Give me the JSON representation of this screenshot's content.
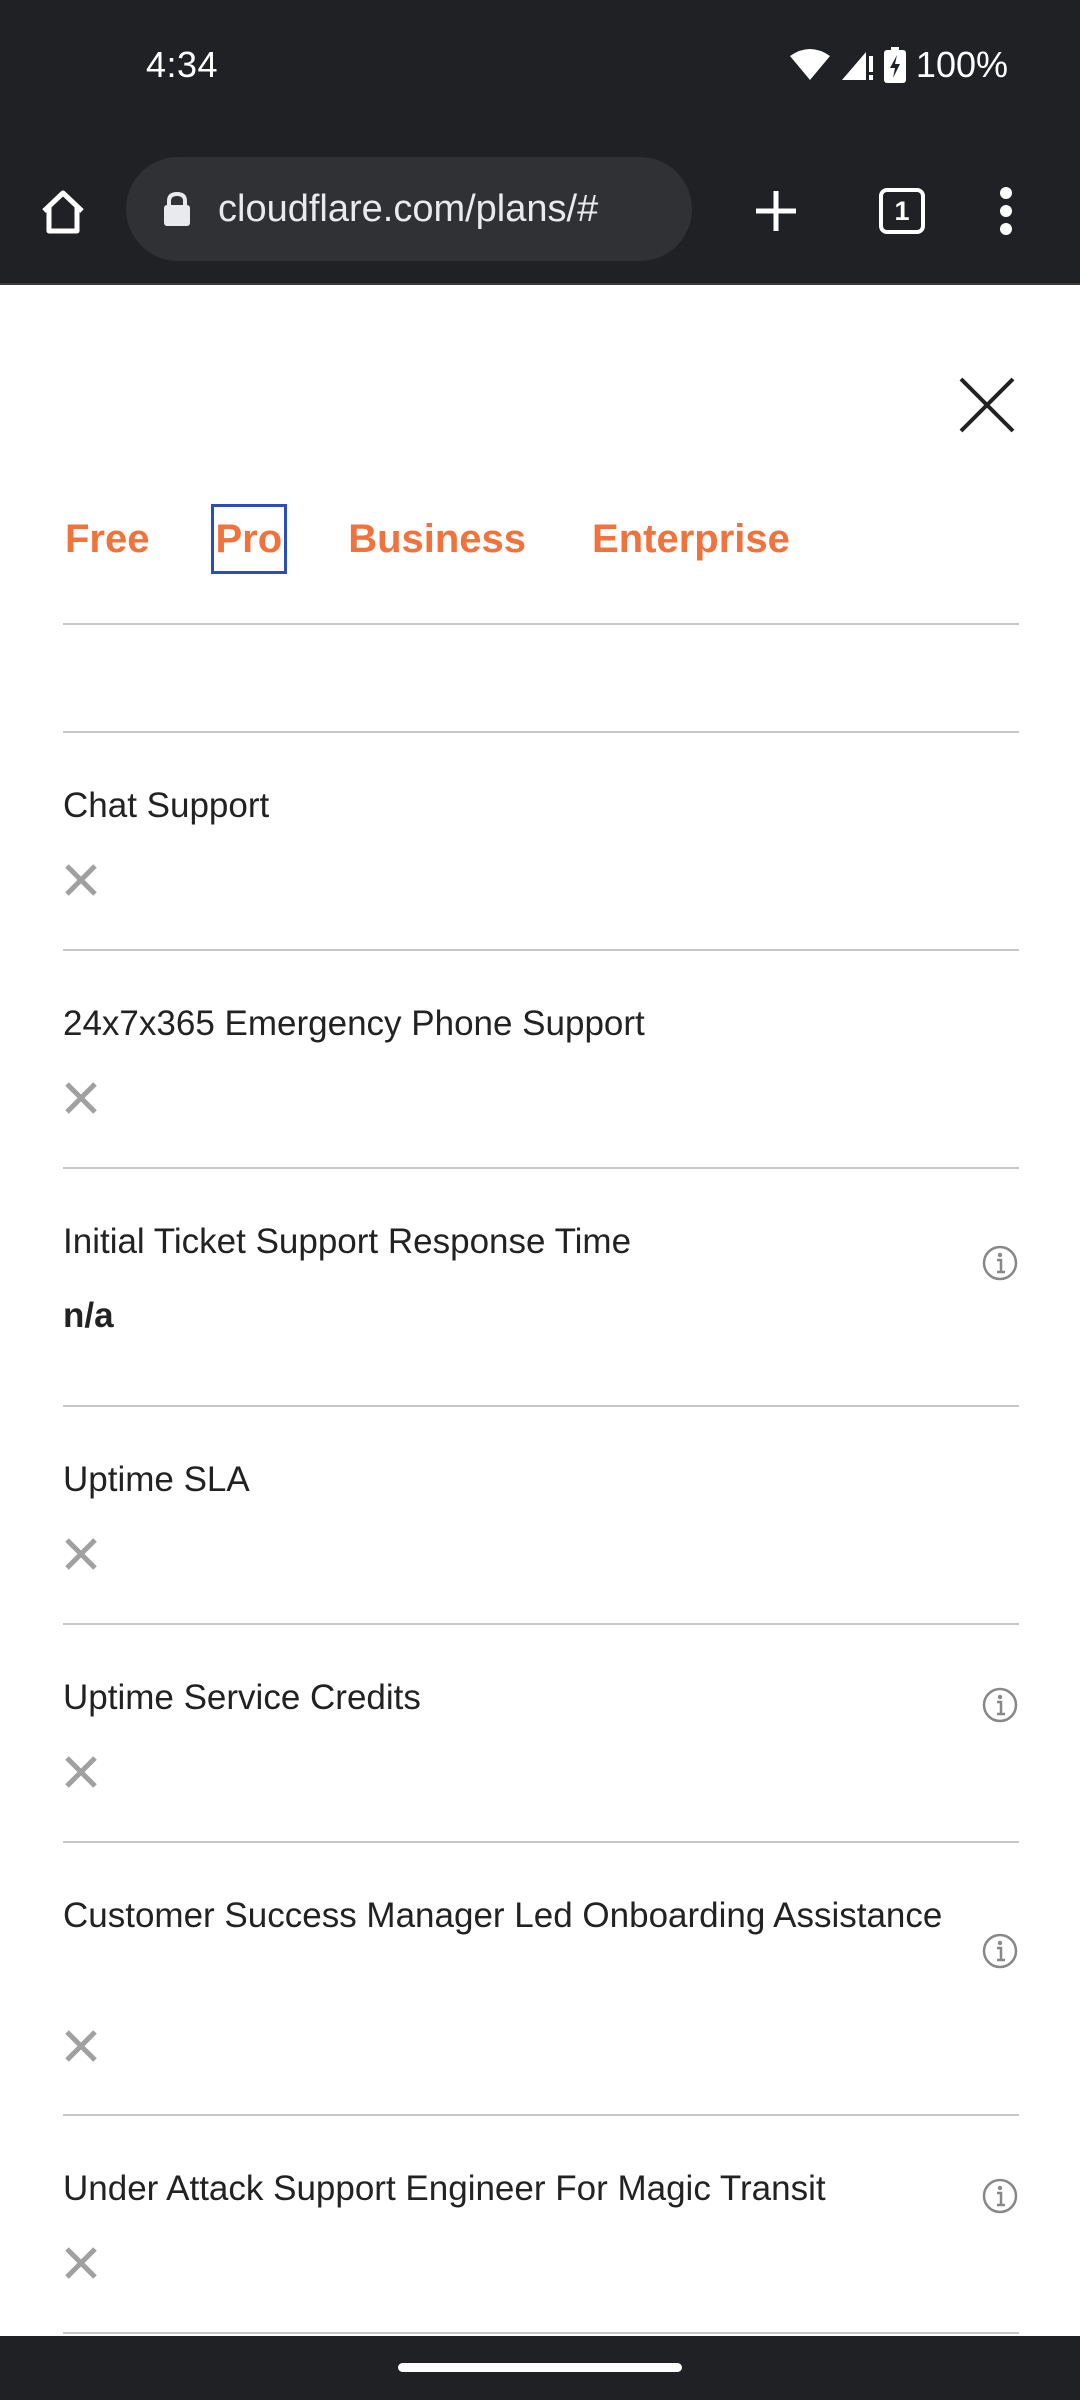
{
  "status_bar": {
    "time": "4:34",
    "battery": "100%",
    "icons": [
      "wifi-icon",
      "signal-icon",
      "battery-charging-icon"
    ]
  },
  "browser": {
    "url": "cloudflare.com/plans/#",
    "tab_count": "1",
    "icons": [
      "home-icon",
      "lock-icon",
      "plus-icon",
      "tab-switcher-icon",
      "more-vert-icon"
    ]
  },
  "plan_tabs": [
    {
      "label": "Free"
    },
    {
      "label": "Pro"
    },
    {
      "label": "Business"
    },
    {
      "label": "Enterprise"
    }
  ],
  "colors": {
    "accent": "#f0723d",
    "focus_outline": "#2a50b8",
    "dark_chrome": "#202124",
    "x_mark": "#a0a0a0"
  },
  "features": [
    {
      "name": "Chat Support",
      "value_icon": "x-icon",
      "info": false
    },
    {
      "name": "24x7x365 Emergency Phone Support",
      "value_icon": "x-icon",
      "info": false
    },
    {
      "name": "Initial Ticket Support Response Time",
      "value_text": "n/a",
      "info": true
    },
    {
      "name": "Uptime SLA",
      "value_icon": "x-icon",
      "info": false
    },
    {
      "name": "Uptime Service Credits",
      "value_icon": "x-icon",
      "info": true
    },
    {
      "name": "Customer Success Manager Led Onboarding Assistance",
      "value_icon": "x-icon",
      "info": true
    },
    {
      "name": "Under Attack Support Engineer For Magic Transit",
      "value_icon": "x-icon",
      "info": true
    }
  ]
}
